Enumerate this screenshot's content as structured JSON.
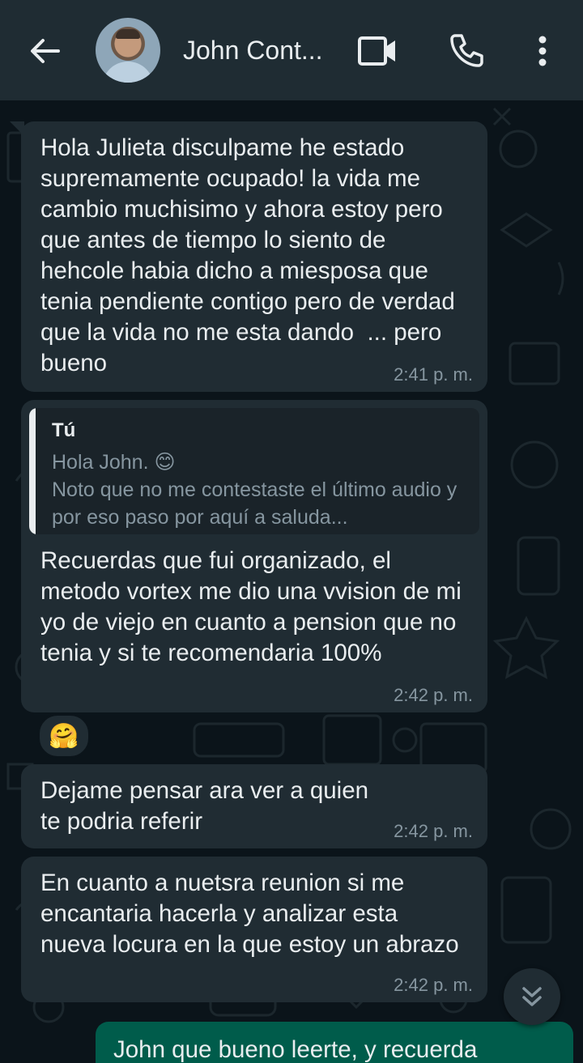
{
  "header": {
    "contact_name": "John Cont...",
    "icons": [
      "back-arrow-icon",
      "avatar",
      "video-call-icon",
      "phone-icon",
      "more-vert-icon"
    ]
  },
  "messages": [
    {
      "text": "Hola Julieta disculpame he estado supremamente ocupado! la vida me cambio muchisimo y ahora estoy pero que antes de tiempo lo siento de hehcole habia dicho a miesposa que tenia pendiente contigo pero de verdad que la vida no me esta dando  ... pero bueno",
      "time": "2:41 p. m."
    },
    {
      "quote_author": "Tú",
      "quote_text": "Hola John. 😊\nNoto que no me contestaste el último audio y por eso paso por aquí a saluda...",
      "text": "Recuerdas que fui organizado, el metodo vortex me dio una vvision de mi yo de viejo en cuanto a pension que no tenia y si te recomendaria 100%",
      "time": "2:42 p. m.",
      "reaction": "🤗"
    },
    {
      "text": "Dejame pensar ara ver a quien te podria referir",
      "time": "2:42 p. m."
    },
    {
      "text": "En cuanto a nuetsra reunion si me encantaria hacerla y analizar esta nueva locura en la que estoy un abrazo",
      "time": "2:42 p. m."
    }
  ],
  "outgoing": {
    "text": "John que bueno leerte, y recuerda"
  },
  "colors": {
    "header_bg": "#1f2c33",
    "chat_bg": "#0b141a",
    "incoming_bubble": "#202c33",
    "outgoing_bubble": "#005c4b",
    "meta_text": "#8696a0"
  }
}
